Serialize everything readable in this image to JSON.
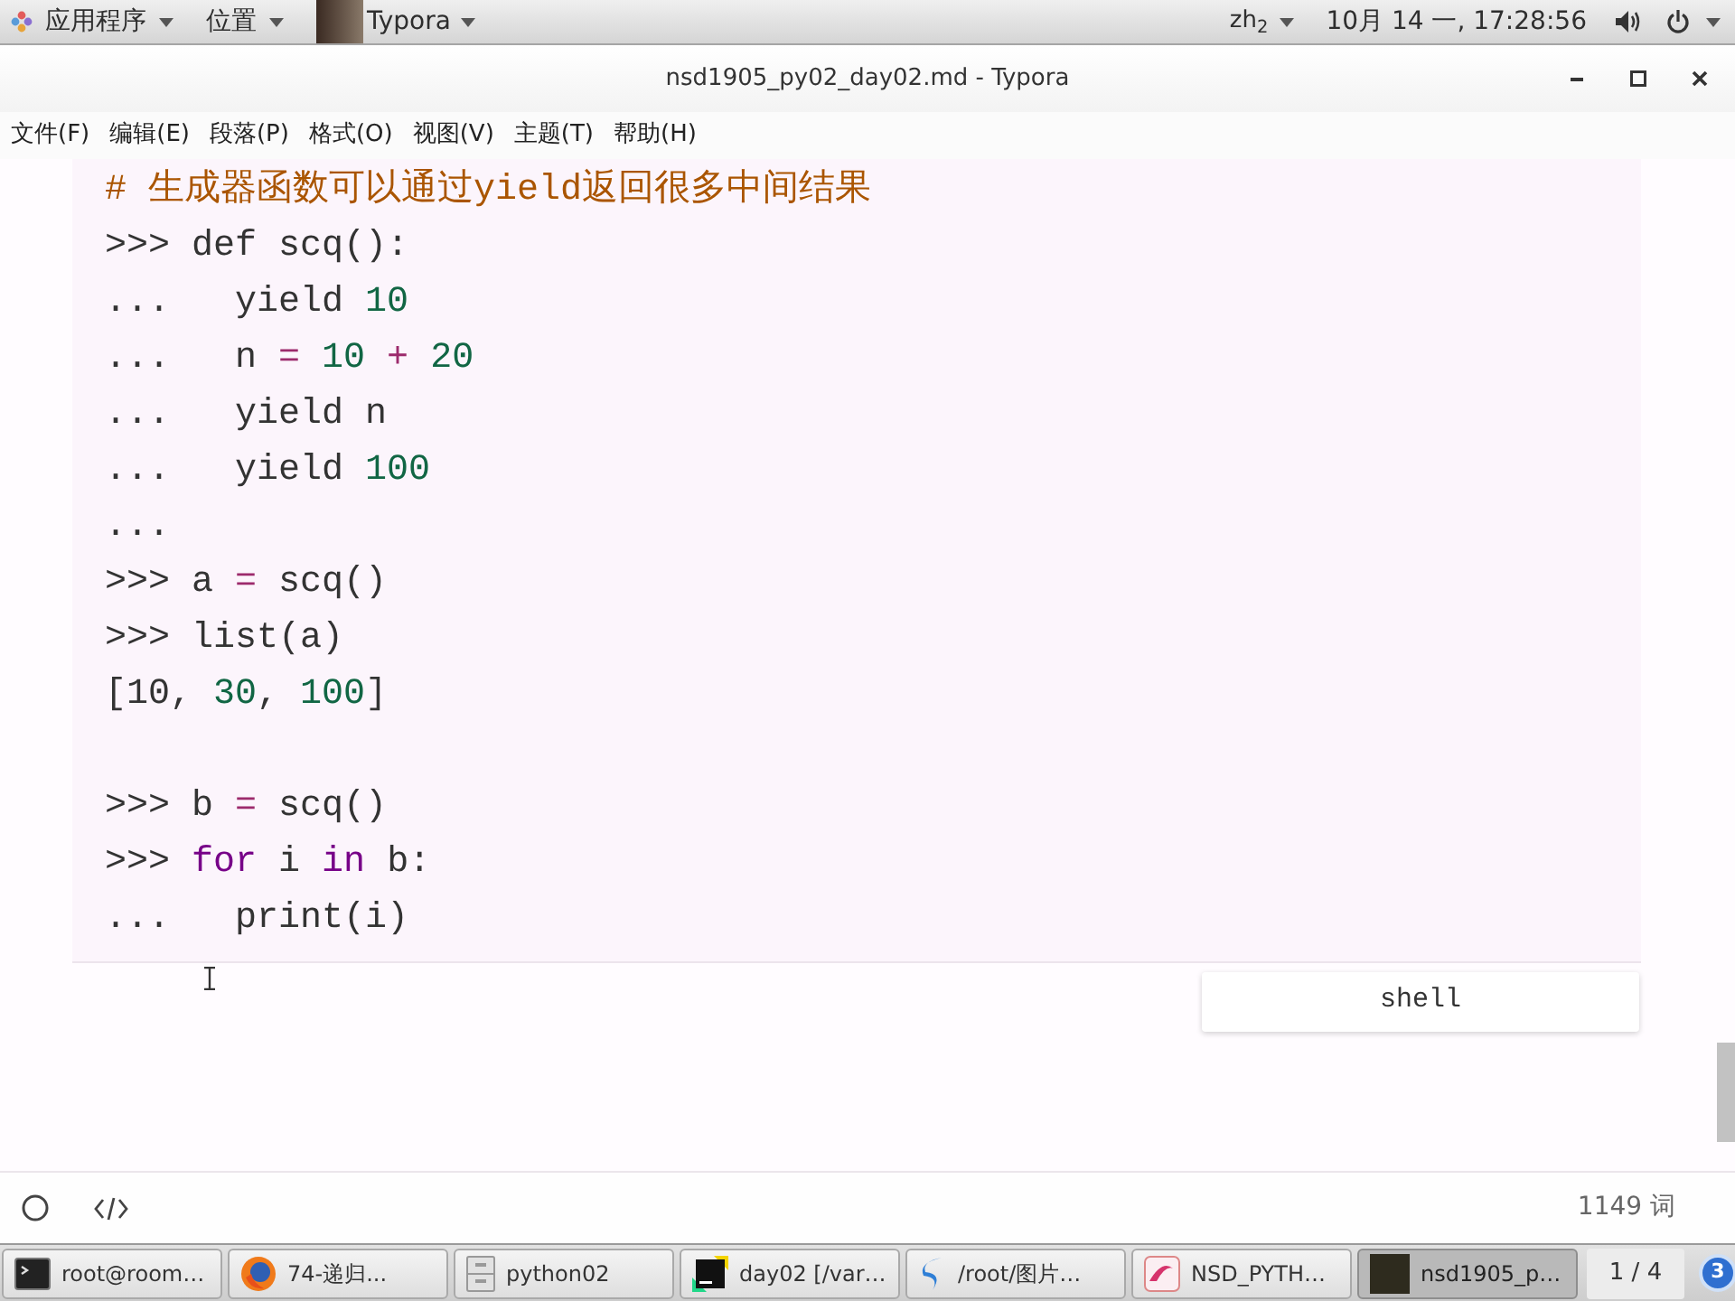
{
  "top_bar": {
    "apps_menu": "应用程序",
    "places_menu": "位置",
    "active_app": "Typora",
    "input_method": "zh$_{2}$",
    "clock": "10月 14 一, 17:28:56"
  },
  "window": {
    "title": "nsd1905_py02_day02.md - Typora"
  },
  "menu_bar": [
    "文件(F)",
    "编辑(E)",
    "段落(P)",
    "格式(O)",
    "视图(V)",
    "主题(T)",
    "帮助(H)"
  ],
  "code_block": {
    "lines": [
      {
        "kind": "code",
        "tokens": [
          {
            "text": "# 生成器函数可以通过yield返回很多中间结果",
            "kind": "comment"
          }
        ]
      },
      {
        "kind": "code",
        "tokens": [
          {
            "text": ">>> def scq():",
            "kind": "plain"
          }
        ]
      },
      {
        "kind": "code",
        "tokens": [
          {
            "text": "...   yield ",
            "kind": "plain"
          },
          {
            "text": "10",
            "kind": "number"
          }
        ]
      },
      {
        "kind": "code",
        "tokens": [
          {
            "text": "...   n",
            "kind": "plain"
          },
          {
            "text": " = ",
            "kind": "operator"
          },
          {
            "text": "10",
            "kind": "number"
          },
          {
            "text": " + ",
            "kind": "operator"
          },
          {
            "text": "20",
            "kind": "number"
          }
        ]
      },
      {
        "kind": "code",
        "tokens": [
          {
            "text": "...   yield n",
            "kind": "plain"
          }
        ]
      },
      {
        "kind": "code",
        "tokens": [
          {
            "text": "...   yield ",
            "kind": "plain"
          },
          {
            "text": "100",
            "kind": "number"
          }
        ]
      },
      {
        "kind": "code",
        "tokens": [
          {
            "text": "...",
            "kind": "plain"
          }
        ]
      },
      {
        "kind": "code",
        "tokens": [
          {
            "text": ">>> a",
            "kind": "plain"
          },
          {
            "text": " = ",
            "kind": "operator"
          },
          {
            "text": "scq()",
            "kind": "plain"
          }
        ]
      },
      {
        "kind": "code",
        "tokens": [
          {
            "text": ">>> list(a)",
            "kind": "plain"
          }
        ]
      },
      {
        "kind": "code",
        "tokens": [
          {
            "text": "[10, ",
            "kind": "plain"
          },
          {
            "text": "30",
            "kind": "number"
          },
          {
            "text": ", ",
            "kind": "plain"
          },
          {
            "text": "100",
            "kind": "number"
          },
          {
            "text": "]",
            "kind": "plain"
          }
        ]
      },
      {
        "kind": "blank"
      },
      {
        "kind": "code",
        "tokens": [
          {
            "text": ">>> b",
            "kind": "plain"
          },
          {
            "text": " = ",
            "kind": "operator"
          },
          {
            "text": "scq()",
            "kind": "plain"
          }
        ]
      },
      {
        "kind": "code",
        "tokens": [
          {
            "text": ">>> ",
            "kind": "plain"
          },
          {
            "text": "for",
            "kind": "keyword"
          },
          {
            "text": " i ",
            "kind": "plain"
          },
          {
            "text": "in",
            "kind": "keyword"
          },
          {
            "text": " b:",
            "kind": "plain"
          }
        ]
      },
      {
        "kind": "code",
        "tokens": [
          {
            "text": "...   print(i)",
            "kind": "plain"
          }
        ]
      }
    ],
    "language": "shell"
  },
  "status_bar": {
    "word_count": "1149 词"
  },
  "taskbar": {
    "tasks": [
      {
        "label": "root@room…",
        "kind": "terminal",
        "selected": false
      },
      {
        "label": "74-递归...",
        "kind": "browser",
        "selected": false
      },
      {
        "label": "python02",
        "kind": "files",
        "selected": false
      },
      {
        "label": "day02 [/var…",
        "kind": "ide",
        "selected": false
      },
      {
        "label": "/root/图片…",
        "kind": "swirl",
        "selected": false
      },
      {
        "label": "NSD_PYTH…",
        "kind": "document",
        "selected": false
      },
      {
        "label": "nsd1905_p…",
        "kind": "thumbnail",
        "selected": true
      }
    ],
    "workspace": "1 / 4",
    "notification_count": "3"
  }
}
